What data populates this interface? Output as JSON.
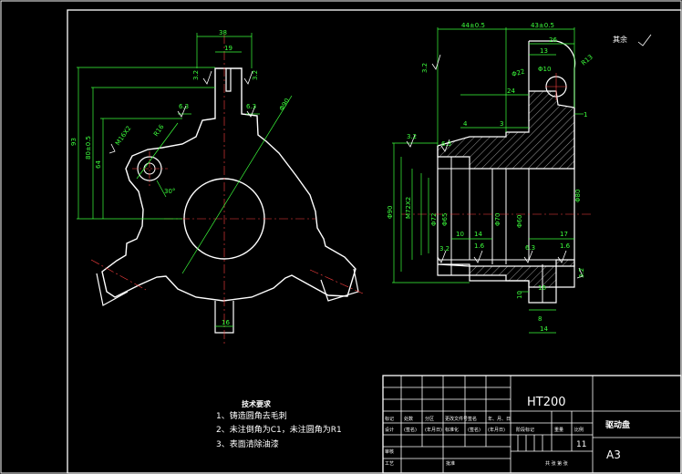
{
  "front_view": {
    "dims": {
      "width_38": "38",
      "width_19": "19",
      "r_3_2": "3.2",
      "r_3_2b": "3.2",
      "r_6_3": "6.3",
      "r_6_3b": "6.3",
      "h_93": "93",
      "h_80": "80±0.5",
      "h_64": "64",
      "m16": "M16X2",
      "r16": "R16",
      "d90": "Φ90",
      "ang30": "30°",
      "bot16": "16"
    }
  },
  "side_view": {
    "dims": {
      "w44": "44±0.5",
      "w43": "43±0.5",
      "w26": "26",
      "w13": "13",
      "r13": "R13",
      "d22": "Φ22",
      "d10": "Φ10",
      "w24": "24",
      "w4": "4",
      "w3": "3",
      "n1": "1",
      "r32": "3.2",
      "r63": "6.3",
      "r32b": "3.2",
      "r32c": "3.2",
      "d90": "Φ90",
      "m72": "M72X2",
      "d72": "Φ72",
      "d65": "Φ65",
      "d70": "Φ70",
      "d60": "Φ60",
      "d80": "Φ80",
      "w10": "10",
      "w14a": "14",
      "w17": "17",
      "w16a": "16",
      "w16b": "16",
      "r63b": "6.3",
      "w10b": "10",
      "w8": "8",
      "w14b": "14",
      "r32d": "3.2",
      "r16": "1.6",
      "r16b": "1.6"
    }
  },
  "surface_mark": "其余",
  "tech_requirements": {
    "title": "技术要求",
    "items": [
      "1、铸造圆角去毛刺",
      "2、未注倒角为C1，未注圆角为R1",
      "3、表面清除油漆"
    ]
  },
  "title_block": {
    "material": "HT200",
    "part_name": "驱动盘",
    "sheet_size": "A3",
    "count": "11",
    "row_labels": [
      "标记",
      "处数",
      "分区",
      "更改文件号",
      "签名",
      "年、月、日"
    ],
    "row2_labels": [
      "设计",
      "(签名)",
      "(年月日)",
      "标准化",
      "(签名)",
      "(年月日)"
    ],
    "stage_label": "阶段标记",
    "weight_label": "重量",
    "scale_label": "比例",
    "check_label": "审核",
    "craft_label": "工艺",
    "approve_label": "批准",
    "sheet_label": "共 张 第 张"
  }
}
